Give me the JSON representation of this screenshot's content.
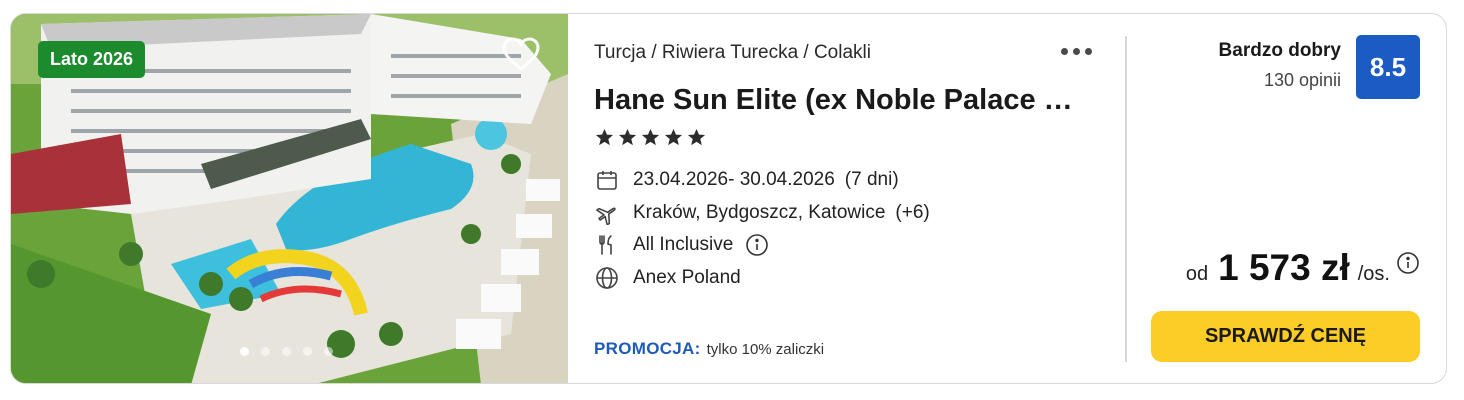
{
  "offer": {
    "season_badge": "Lato 2026",
    "image_count": 5,
    "active_image": 1,
    "breadcrumb": "Turcja / Riwiera Turecka / Colakli",
    "hotel_name": "Hane Sun Elite (ex Noble Palace …",
    "stars": 5,
    "dates": "23.04.2026- 30.04.2026",
    "duration": "(7 dni)",
    "departures": "Kraków, Bydgoszcz, Katowice",
    "departures_more": "(+6)",
    "board": "All Inclusive",
    "operator": "Anex Poland",
    "promo_label": "PROMOCJA:",
    "promo_text": "tylko 10% zaliczki",
    "rating_label": "Bardzo dobry",
    "reviews": "130 opinii",
    "score": "8.5",
    "price_prefix": "od",
    "price": "1 573 zł",
    "price_suffix": "/os.",
    "cta_label": "SPRAWDŹ CENĘ"
  },
  "icons": {
    "favorite": "heart-outline-icon",
    "more": "more-dots-icon",
    "star": "star-icon",
    "dates": "calendar-icon",
    "departures": "plane-icon",
    "board": "cutlery-icon",
    "board_info": "info-circle-icon",
    "operator": "globe-icon",
    "price_info": "info-circle-icon"
  },
  "colors": {
    "season_badge": "#1c8b2e",
    "score_badge": "#1a5bc4",
    "promo_label": "#1e5bb8",
    "cta": "#fccc27"
  }
}
